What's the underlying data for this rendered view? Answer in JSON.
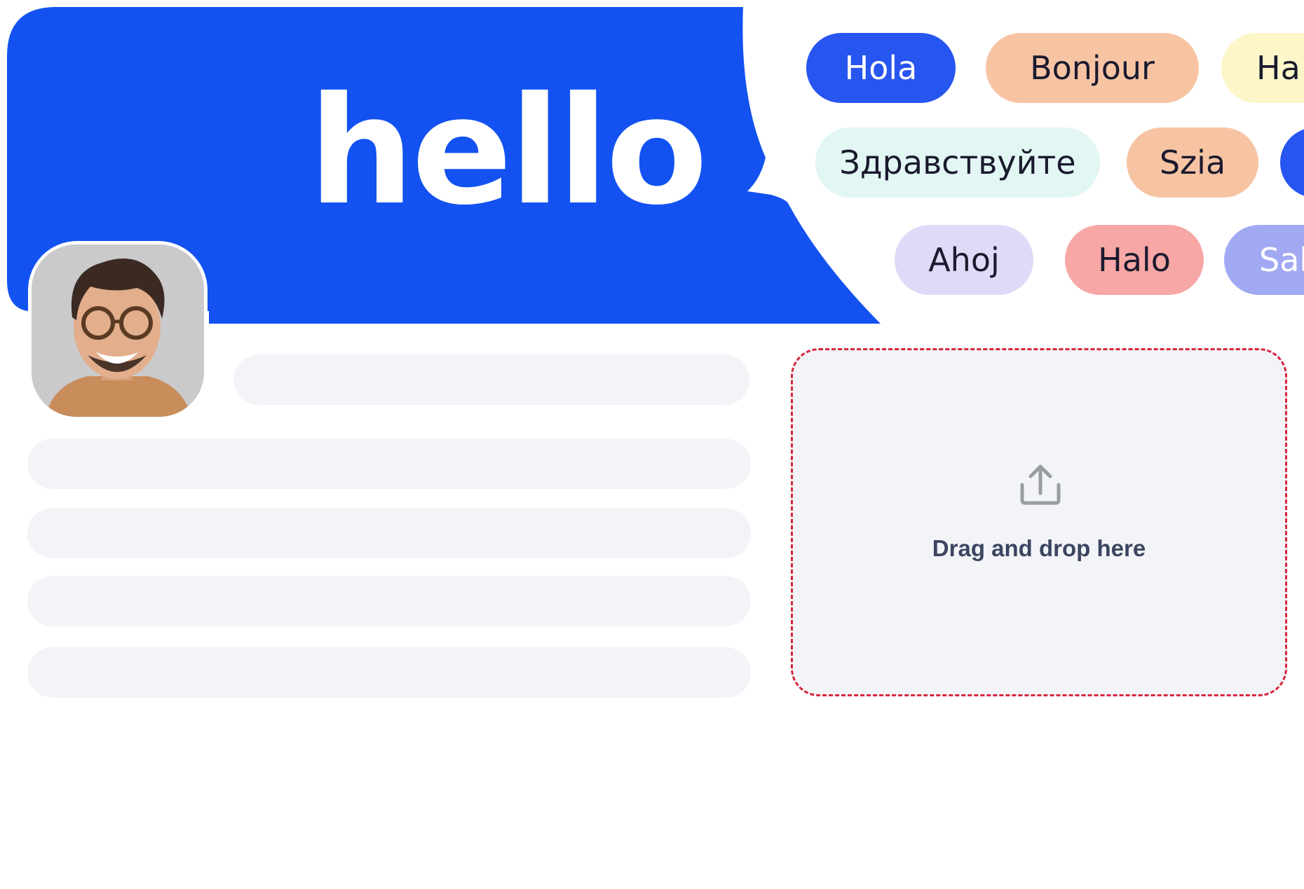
{
  "hero": {
    "text": "hello",
    "color": "#1352f1"
  },
  "avatar": {
    "description": "profile-photo"
  },
  "greetings": [
    {
      "label": "Hola",
      "bg": "#2755ef",
      "fg": "#ffffff"
    },
    {
      "label": "Bonjour",
      "bg": "#f7c4a3",
      "fg": "#1a1a2e"
    },
    {
      "label": "Ha",
      "bg": "#fcf6c8",
      "fg": "#1a1a2e"
    },
    {
      "label": "Здравствуйте",
      "bg": "#e2f6f3",
      "fg": "#1a1a2e"
    },
    {
      "label": "Szia",
      "bg": "#f7c4a3",
      "fg": "#1a1a2e"
    },
    {
      "label": "",
      "bg": "#2755ef",
      "fg": "#ffffff"
    },
    {
      "label": "Ahoj",
      "bg": "#e0daf8",
      "fg": "#1a1a2e"
    },
    {
      "label": "Halo",
      "bg": "#f7a7a5",
      "fg": "#1a1a2e"
    },
    {
      "label": "Sal",
      "bg": "#a2a9f3",
      "fg": "#ffffff"
    }
  ],
  "dropzone": {
    "label": "Drag and drop here",
    "icon": "upload-icon",
    "border_color": "#d9263d"
  }
}
